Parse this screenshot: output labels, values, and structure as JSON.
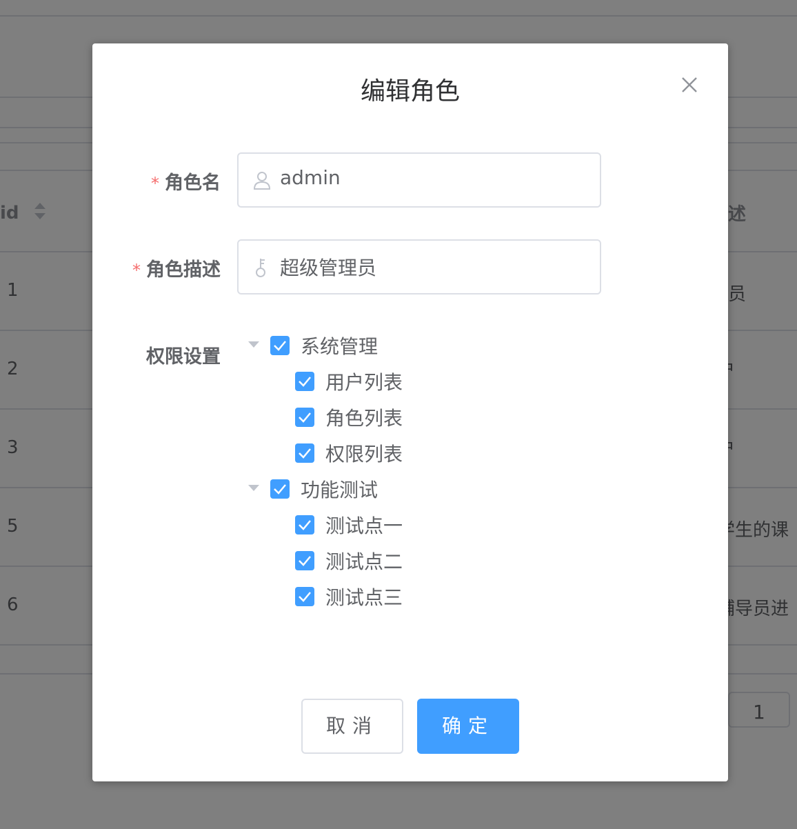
{
  "background": {
    "id_header": "角色id",
    "desc_header": "描述",
    "ids": [
      "1",
      "2",
      "3",
      "5",
      "6"
    ],
    "desc_fragments": [
      "理员",
      "户",
      "户",
      "学生的课",
      "辅导员进"
    ],
    "pager_current": "1"
  },
  "dialog": {
    "title": "编辑角色",
    "close_icon": "close-icon",
    "fields": {
      "role_name": {
        "label": "角色名",
        "value": "admin",
        "required": "*",
        "icon": "user-icon"
      },
      "role_desc": {
        "label": "角色描述",
        "value": "超级管理员",
        "required": "*",
        "icon": "key-icon"
      }
    },
    "permission_label": "权限设置",
    "tree": [
      {
        "label": "系统管理",
        "checked": true,
        "children": [
          {
            "label": "用户列表",
            "checked": true
          },
          {
            "label": "角色列表",
            "checked": true
          },
          {
            "label": "权限列表",
            "checked": true
          }
        ]
      },
      {
        "label": "功能测试",
        "checked": true,
        "children": [
          {
            "label": "测试点一",
            "checked": true
          },
          {
            "label": "测试点二",
            "checked": true
          },
          {
            "label": "测试点三",
            "checked": true
          }
        ]
      }
    ],
    "cancel_label": "取消",
    "confirm_label": "确定"
  },
  "colors": {
    "primary": "#409eff",
    "required": "#f56c6c",
    "overlay": "rgba(0,0,0,0.5)"
  }
}
